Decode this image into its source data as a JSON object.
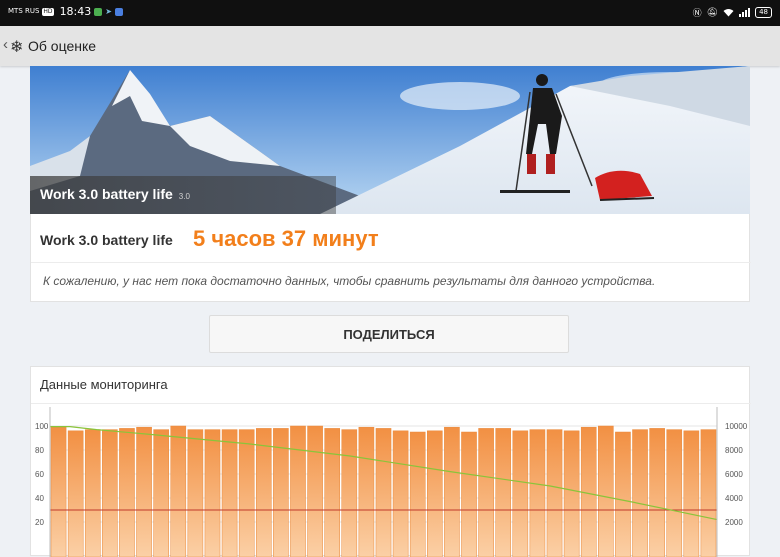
{
  "status_bar": {
    "carrier": "MTS RUS",
    "network_badge": "HD",
    "time": "18:43",
    "battery": "48",
    "icons": [
      "nfc-icon",
      "mute-icon",
      "wifi-icon",
      "signal-icon"
    ]
  },
  "app_bar": {
    "title": "Об оценке",
    "icons": [
      "back-arrow-icon",
      "snowflake-icon"
    ]
  },
  "hero": {
    "title": "Work 3.0 battery life",
    "version": "3.0"
  },
  "result": {
    "label": "Work 3.0 battery life",
    "value": "5 часов 37 минут",
    "note": "К сожалению, у нас нет пока достаточно данных, чтобы сравнить результаты для данного устройства."
  },
  "share_button": "ПОДЕЛИТЬСЯ",
  "monitoring": {
    "title": "Данные мониторинга"
  },
  "chart_data": {
    "type": "bar",
    "left_axis_ticks": [
      20,
      40,
      60,
      80,
      100
    ],
    "right_axis_ticks": [
      2000,
      4000,
      6000,
      8000,
      10000
    ],
    "left_range": [
      0,
      110
    ],
    "right_range": [
      0,
      11000
    ],
    "bars": [
      99,
      96,
      97,
      97,
      98,
      99,
      97,
      100,
      97,
      97,
      97,
      97,
      98,
      98,
      100,
      100,
      98,
      97,
      99,
      98,
      96,
      95,
      96,
      99,
      95,
      98,
      98,
      96,
      97,
      97,
      96,
      99,
      100,
      95,
      97,
      98,
      97,
      96,
      97
    ],
    "green_line": {
      "x": [
        0,
        0.03,
        0.07,
        0.15,
        0.3,
        0.45,
        0.6,
        0.75,
        0.87,
        1.0
      ],
      "y": [
        99.5,
        99.5,
        97,
        93,
        85,
        75,
        62,
        50,
        37,
        22
      ]
    },
    "red_line_level": 30,
    "colors": {
      "bar_top": "#f29043",
      "bar_bottom": "#fbd0a6",
      "green": "#8ac43a",
      "red": "#c0392b",
      "accent": "#f27f1b"
    }
  }
}
